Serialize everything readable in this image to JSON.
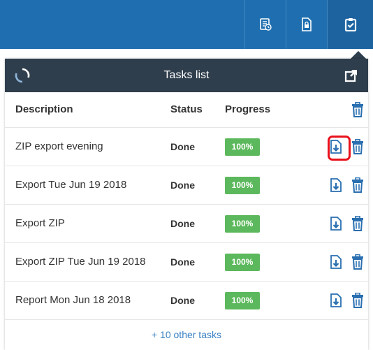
{
  "toolbar": {
    "icons": [
      "task-report-icon",
      "locked-file-icon",
      "tasks-clipboard-icon"
    ]
  },
  "panel": {
    "title": "Tasks list",
    "columns": {
      "description": "Description",
      "status": "Status",
      "progress": "Progress"
    },
    "rows": [
      {
        "description": "ZIP export evening",
        "status": "Done",
        "progress": "100%"
      },
      {
        "description": "Export Tue Jun 19 2018",
        "status": "Done",
        "progress": "100%"
      },
      {
        "description": "Export ZIP",
        "status": "Done",
        "progress": "100%"
      },
      {
        "description": "Export ZIP Tue Jun 19 2018",
        "status": "Done",
        "progress": "100%"
      },
      {
        "description": "Report Mon Jun 18 2018",
        "status": "Done",
        "progress": "100%"
      }
    ],
    "more_link": "+ 10 other tasks"
  },
  "colors": {
    "topbar": "#1f6fb0",
    "panel_header": "#2f3e4d",
    "progress": "#5cb85c",
    "icon_blue": "#2a6fb0",
    "highlight": "#e8111b"
  }
}
